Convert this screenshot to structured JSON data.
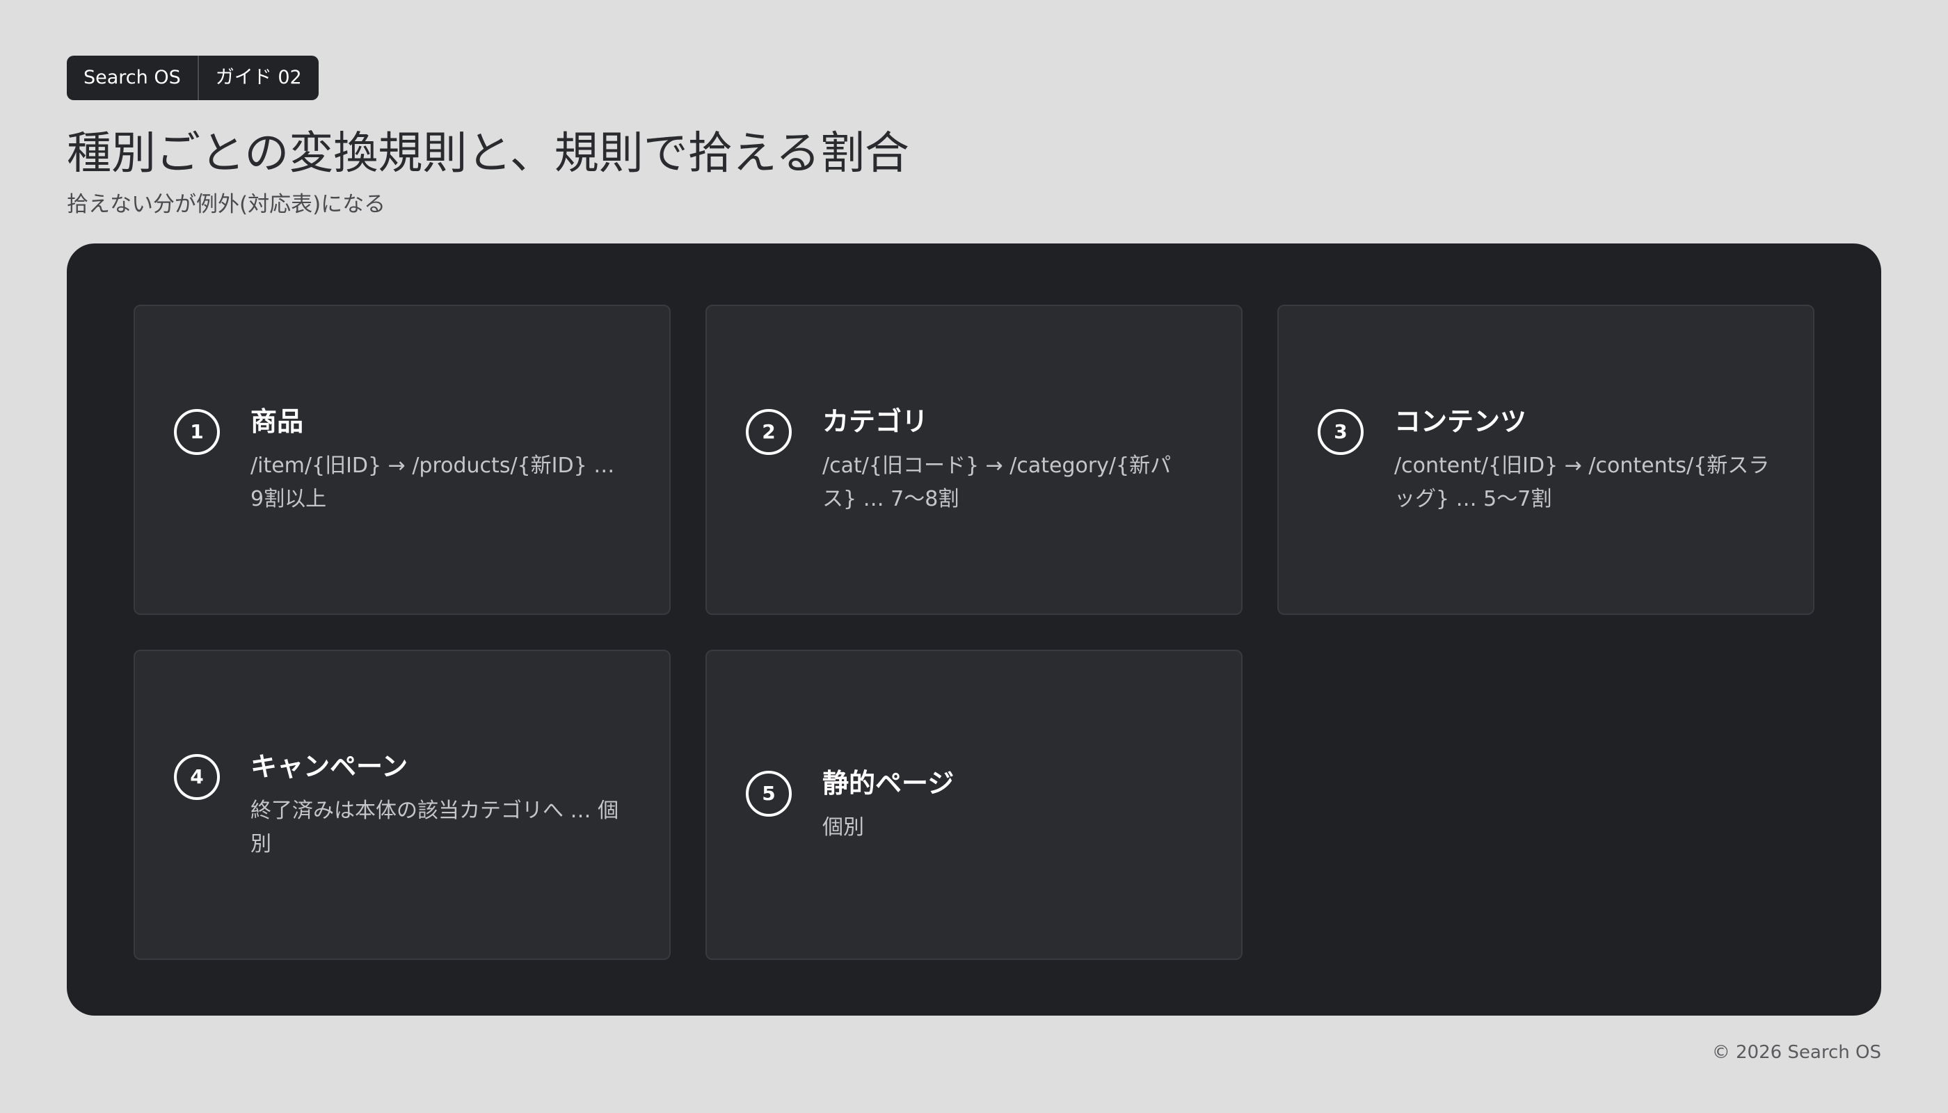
{
  "breadcrumb": {
    "brand": "Search OS",
    "section": "ガイド 02"
  },
  "page": {
    "title": "種別ごとの変換規則と、規則で拾える割合",
    "subtitle": "拾えない分が例外(対応表)になる"
  },
  "cards": [
    {
      "number": "1",
      "title": "商品",
      "description": "/item/{旧ID} → /products/{新ID} … 9割以上"
    },
    {
      "number": "2",
      "title": "カテゴリ",
      "description": "/cat/{旧コード} → /category/{新パス} … 7〜8割"
    },
    {
      "number": "3",
      "title": "コンテンツ",
      "description": "/content/{旧ID} → /contents/{新スラッグ} … 5〜7割"
    },
    {
      "number": "4",
      "title": "キャンペーン",
      "description": "終了済みは本体の該当カテゴリへ … 個別"
    },
    {
      "number": "5",
      "title": "静的ページ",
      "description": "個別"
    }
  ],
  "footer": {
    "copyright": "© 2026 Search OS"
  },
  "colors": {
    "background": "#dedede",
    "panel": "#202124",
    "card": "#2a2c30",
    "card_border": "#383a3f",
    "text_primary": "#ffffff",
    "text_secondary": "#c4c6ca"
  }
}
